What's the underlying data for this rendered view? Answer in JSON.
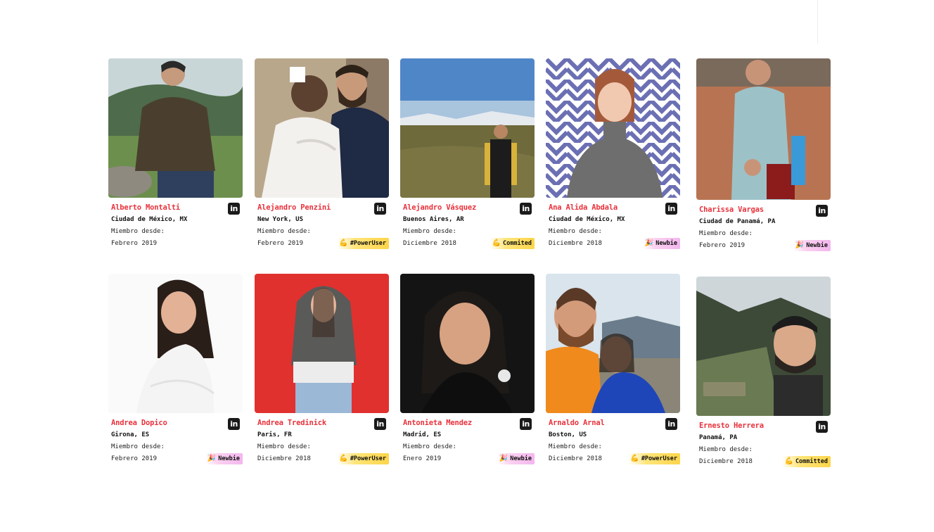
{
  "members": [
    {
      "name": "Alberto Montalti",
      "location": "Ciudad de México, MX",
      "since_label": "Miembro desde:",
      "since_date": "Febrero 2019",
      "badge": null
    },
    {
      "name": "Alejandro Penzini",
      "location": "New York, US",
      "since_label": "Miembro desde:",
      "since_date": "Febrero 2019",
      "badge": {
        "label": "#PowerUser",
        "type": "power",
        "icon": "flexed-arm-icon"
      }
    },
    {
      "name": "Alejandro Vásquez",
      "location": "Buenos Aires, AR",
      "since_label": "Miembro desde:",
      "since_date": "Diciembre 2018",
      "badge": {
        "label": "Commited",
        "type": "commit",
        "icon": "flexed-arm-icon"
      }
    },
    {
      "name": "Ana Alida Abdala",
      "location": "Ciudad de México, MX",
      "since_label": "Miembro desde:",
      "since_date": "Diciembre 2018",
      "badge": {
        "label": "Newbie",
        "type": "newbie",
        "icon": "party-popper-icon"
      }
    },
    {
      "name": "Charissa Vargas",
      "location": "Ciudad de Panamá, PA",
      "since_label": "Miembro desde:",
      "since_date": "Febrero 2019",
      "badge": {
        "label": "Newbie",
        "type": "newbie",
        "icon": "party-popper-icon"
      }
    },
    {
      "name": "Andrea Dopico",
      "location": "Girona, ES",
      "since_label": "Miembro desde:",
      "since_date": "Febrero 2019",
      "badge": {
        "label": "Newbie",
        "type": "newbie",
        "icon": "party-popper-icon"
      }
    },
    {
      "name": "Andrea Tredinick",
      "location": "Paris, FR",
      "since_label": "Miembro desde:",
      "since_date": "Diciembre 2018",
      "badge": {
        "label": "#PowerUser",
        "type": "power",
        "icon": "flexed-arm-icon"
      }
    },
    {
      "name": "Antonieta Mendez",
      "location": "Madrid, ES",
      "since_label": "Miembro desde:",
      "since_date": "Enero 2019",
      "badge": {
        "label": "Newbie",
        "type": "newbie",
        "icon": "party-popper-icon"
      }
    },
    {
      "name": "Arnaldo Arnal",
      "location": "Boston, US",
      "since_label": "Miembro desde:",
      "since_date": "Diciembre 2018",
      "badge": {
        "label": "#PowerUser",
        "type": "power",
        "icon": "flexed-arm-icon"
      }
    },
    {
      "name": "Ernesto Herrera",
      "location": "Panamá, PA",
      "since_label": "Miembro desde:",
      "since_date": "Diciembre 2018",
      "badge": {
        "label": "Committed",
        "type": "commit",
        "icon": "flexed-arm-icon"
      }
    }
  ],
  "linkedin_label": "in",
  "colors": {
    "name": "#e8323c",
    "newbie": "#f3b6ee",
    "power": "#fcd54a",
    "linkedin": "#1a1a1a"
  }
}
